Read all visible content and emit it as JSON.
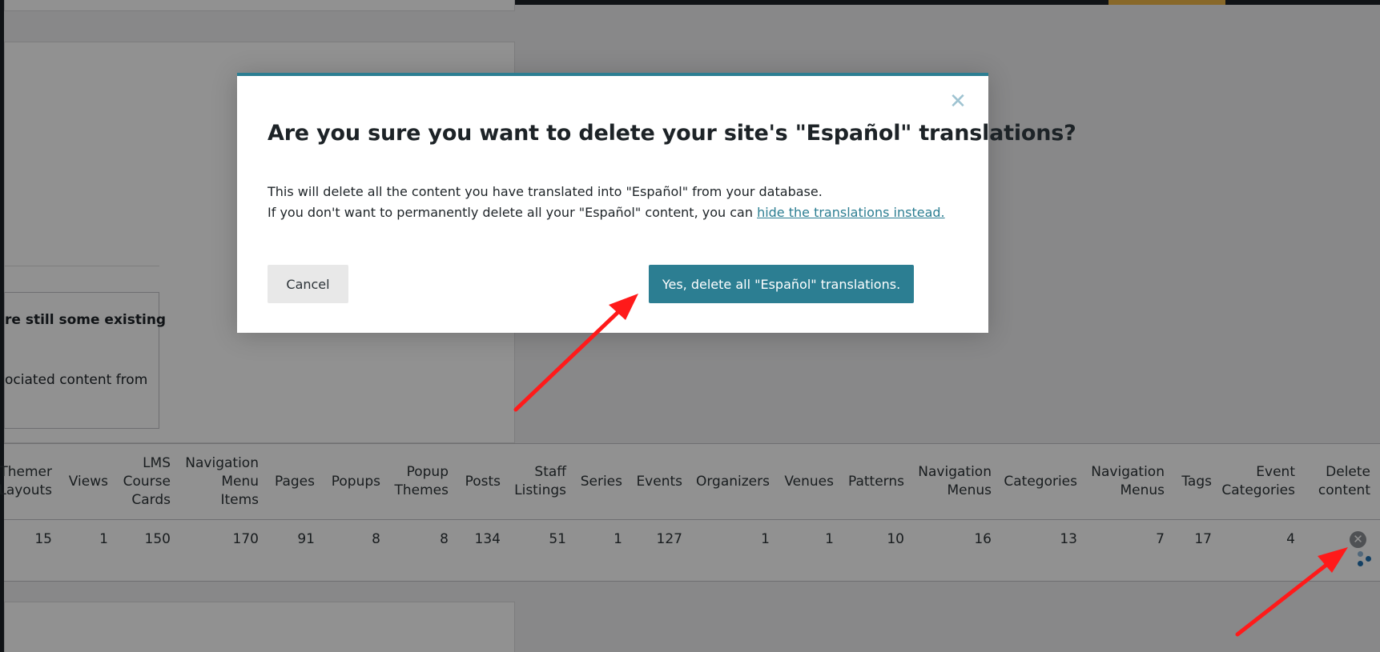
{
  "background": {
    "notice": {
      "line1": "re still some existing",
      "line2": "ociated content from"
    },
    "table": {
      "headers": [
        [
          "Themer",
          "Layouts"
        ],
        [
          "Views"
        ],
        [
          "LMS",
          "Course",
          "Cards"
        ],
        [
          "Navigation",
          "Menu",
          "Items"
        ],
        [
          "Pages"
        ],
        [
          "Popups"
        ],
        [
          "Popup",
          "Themes"
        ],
        [
          "Posts"
        ],
        [
          "Staff",
          "Listings"
        ],
        [
          "Series"
        ],
        [
          "Events"
        ],
        [
          "Organizers"
        ],
        [
          "Venues"
        ],
        [
          "Patterns"
        ],
        [
          "Navigation",
          "Menus"
        ],
        [
          "Categories"
        ],
        [
          "Navigation",
          "Menus"
        ],
        [
          "Tags"
        ],
        [
          "Event",
          "Categories"
        ],
        [
          "Delete",
          "content"
        ]
      ],
      "values": [
        "15",
        "1",
        "150",
        "170",
        "91",
        "8",
        "8",
        "134",
        "51",
        "1",
        "127",
        "1",
        "1",
        "10",
        "16",
        "13",
        "7",
        "17",
        "4"
      ],
      "delete_icon": "circle-x-icon"
    }
  },
  "modal": {
    "title": "Are you sure you want to delete your site's \"Español\" translations?",
    "body_line1": "This will delete all the content you have translated into \"Español\" from your database.",
    "body_line2_prefix": "If you don't want to permanently delete all your \"Español\" content, you can ",
    "body_link": "hide the translations instead.",
    "cancel_label": "Cancel",
    "confirm_label": "Yes, delete all \"Español\" translations.",
    "close_icon": "close-icon"
  },
  "colors": {
    "accent": "#2c7e92",
    "annotation_arrow": "#ff1a1a",
    "admin_bar_highlight": "#f0b849"
  }
}
